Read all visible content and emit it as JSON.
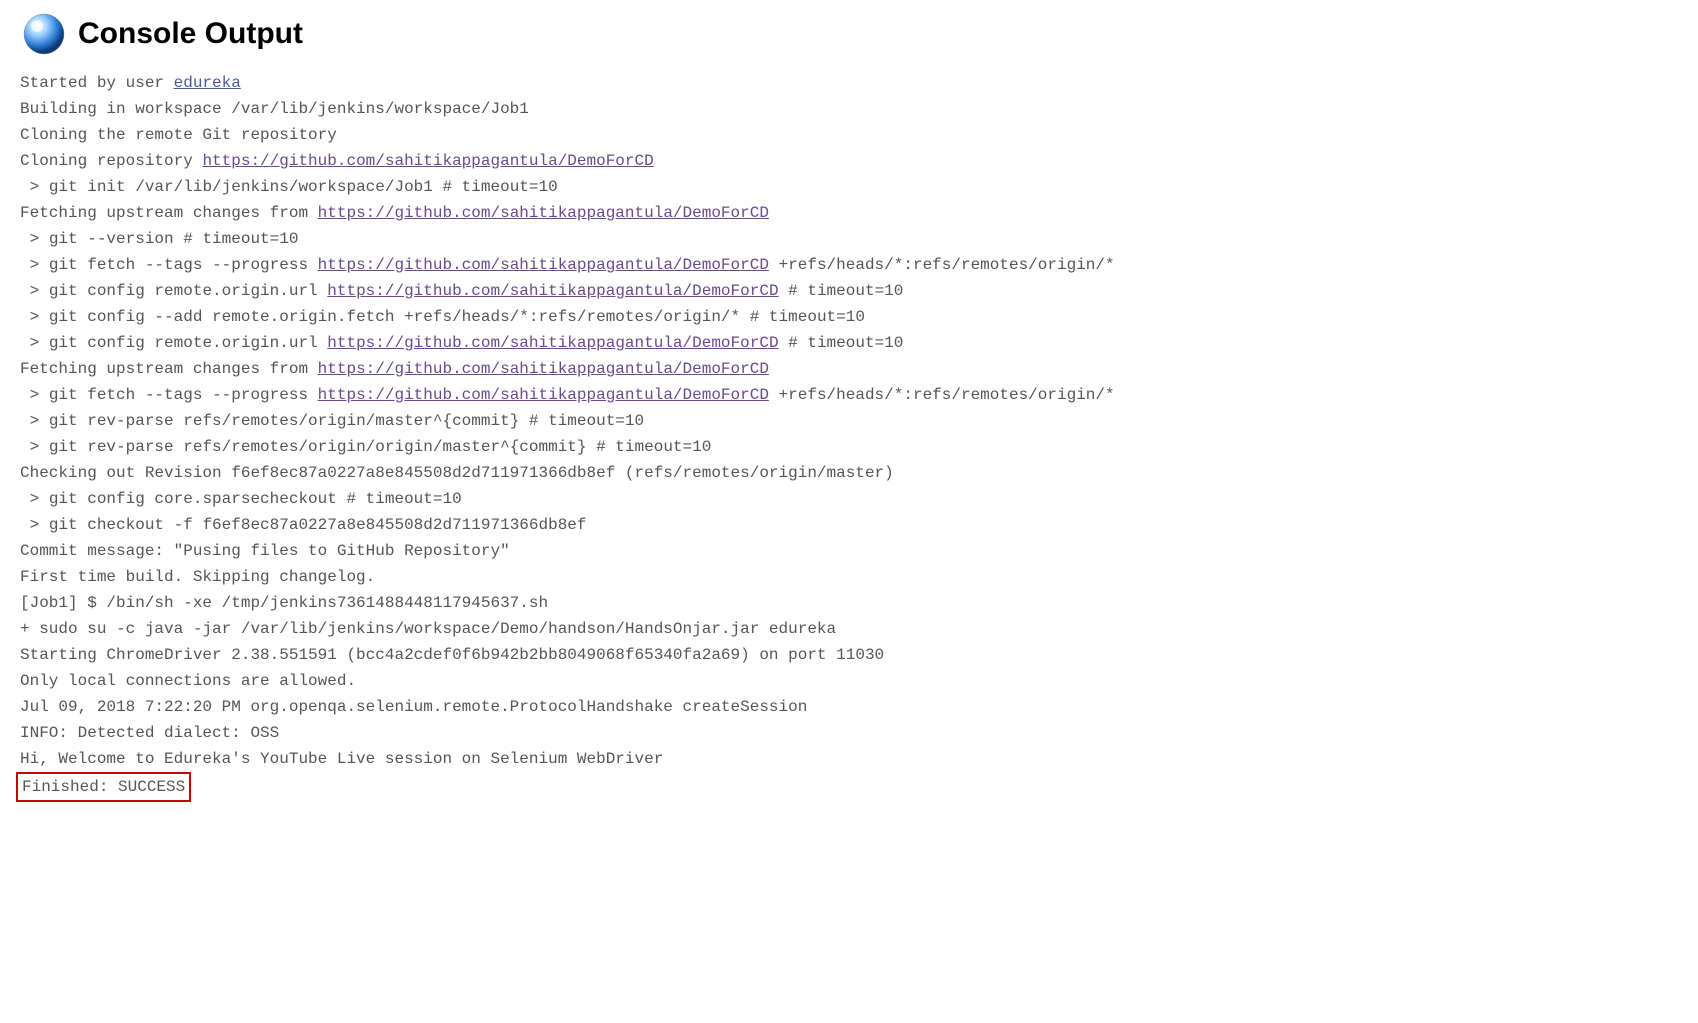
{
  "header": {
    "title": "Console Output"
  },
  "console": {
    "line1_prefix": "Started by user ",
    "line1_link": "edureka",
    "line2": "Building in workspace /var/lib/jenkins/workspace/Job1",
    "line3": "Cloning the remote Git repository",
    "line4_prefix": "Cloning repository ",
    "line4_link": "https://github.com/sahitikappagantula/DemoForCD",
    "line5": " > git init /var/lib/jenkins/workspace/Job1 # timeout=10",
    "line6_prefix": "Fetching upstream changes from ",
    "line6_link": "https://github.com/sahitikappagantula/DemoForCD",
    "line7": " > git --version # timeout=10",
    "line8_prefix": " > git fetch --tags --progress ",
    "line8_link": "https://github.com/sahitikappagantula/DemoForCD",
    "line8_suffix": " +refs/heads/*:refs/remotes/origin/*",
    "line9_prefix": " > git config remote.origin.url ",
    "line9_link": "https://github.com/sahitikappagantula/DemoForCD",
    "line9_suffix": " # timeout=10",
    "line10": " > git config --add remote.origin.fetch +refs/heads/*:refs/remotes/origin/* # timeout=10",
    "line11_prefix": " > git config remote.origin.url ",
    "line11_link": "https://github.com/sahitikappagantula/DemoForCD",
    "line11_suffix": " # timeout=10",
    "line12_prefix": "Fetching upstream changes from ",
    "line12_link": "https://github.com/sahitikappagantula/DemoForCD",
    "line13_prefix": " > git fetch --tags --progress ",
    "line13_link": "https://github.com/sahitikappagantula/DemoForCD",
    "line13_suffix": " +refs/heads/*:refs/remotes/origin/*",
    "line14": " > git rev-parse refs/remotes/origin/master^{commit} # timeout=10",
    "line15": " > git rev-parse refs/remotes/origin/origin/master^{commit} # timeout=10",
    "line16": "Checking out Revision f6ef8ec87a0227a8e845508d2d711971366db8ef (refs/remotes/origin/master)",
    "line17": " > git config core.sparsecheckout # timeout=10",
    "line18": " > git checkout -f f6ef8ec87a0227a8e845508d2d711971366db8ef",
    "line19": "Commit message: \"Pusing files to GitHub Repository\"",
    "line20": "First time build. Skipping changelog.",
    "line21": "[Job1] $ /bin/sh -xe /tmp/jenkins7361488448117945637.sh",
    "line22": "+ sudo su -c java -jar /var/lib/jenkins/workspace/Demo/handson/HandsOnjar.jar edureka",
    "line23": "Starting ChromeDriver 2.38.551591 (bcc4a2cdef0f6b942b2bb8049068f65340fa2a69) on port 11030",
    "line24": "Only local connections are allowed.",
    "line25": "Jul 09, 2018 7:22:20 PM org.openqa.selenium.remote.ProtocolHandshake createSession",
    "line26": "INFO: Detected dialect: OSS",
    "line27": "Hi, Welcome to Edureka's YouTube Live session on Selenium WebDriver",
    "line28": "Finished: SUCCESS"
  }
}
